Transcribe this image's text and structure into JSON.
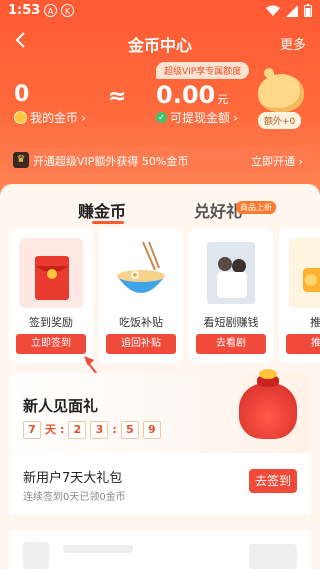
{
  "status_bar": {
    "time": "1:53",
    "icons": [
      "a-circle-icon",
      "k-circle-icon",
      "wifi-icon",
      "signal-icon",
      "battery-icon"
    ],
    "a_letter": "A",
    "k_letter": "K"
  },
  "nav": {
    "title": "金币中心",
    "more": "更多",
    "back_icon": "chevron-left-icon"
  },
  "wallet": {
    "coins_value": "0",
    "coins_label": "我的金币",
    "approx_symbol": "≈",
    "vip_tag": "超级VIP享专属额度",
    "cash_value": "0.00",
    "cash_unit": "元",
    "cash_label": "可提现金额",
    "bonus_label": "额外+0"
  },
  "vip_bar": {
    "text": "开通超级VIP额外获得  50%金币",
    "action": "立即开通"
  },
  "tabs": {
    "earn": "赚金币",
    "gift": "兑好礼",
    "new_badge": "商品上新"
  },
  "tasks": [
    {
      "label": "签到奖励",
      "button": "立即签到",
      "icon": "red-envelope-icon"
    },
    {
      "label": "吃饭补贴",
      "button": "追回补贴",
      "icon": "noodle-bowl-icon"
    },
    {
      "label": "看短剧赚钱",
      "button": "去看剧",
      "icon": "drama-poster-icon"
    },
    {
      "label": "推荐",
      "button": "推币",
      "icon": "coin-machine-icon"
    }
  ],
  "newbie": {
    "title": "新人见面礼",
    "countdown": [
      "7",
      "天",
      ":",
      "2",
      "3",
      ":",
      "5",
      "9"
    ]
  },
  "gift_task": {
    "title": "新用户7天大礼包",
    "subtitle": "连续签到0天已领0金币",
    "button": "去签到"
  },
  "colors": {
    "brand": "#ff5a33",
    "button": "#f04a3a",
    "coin": "#ffc53d"
  }
}
